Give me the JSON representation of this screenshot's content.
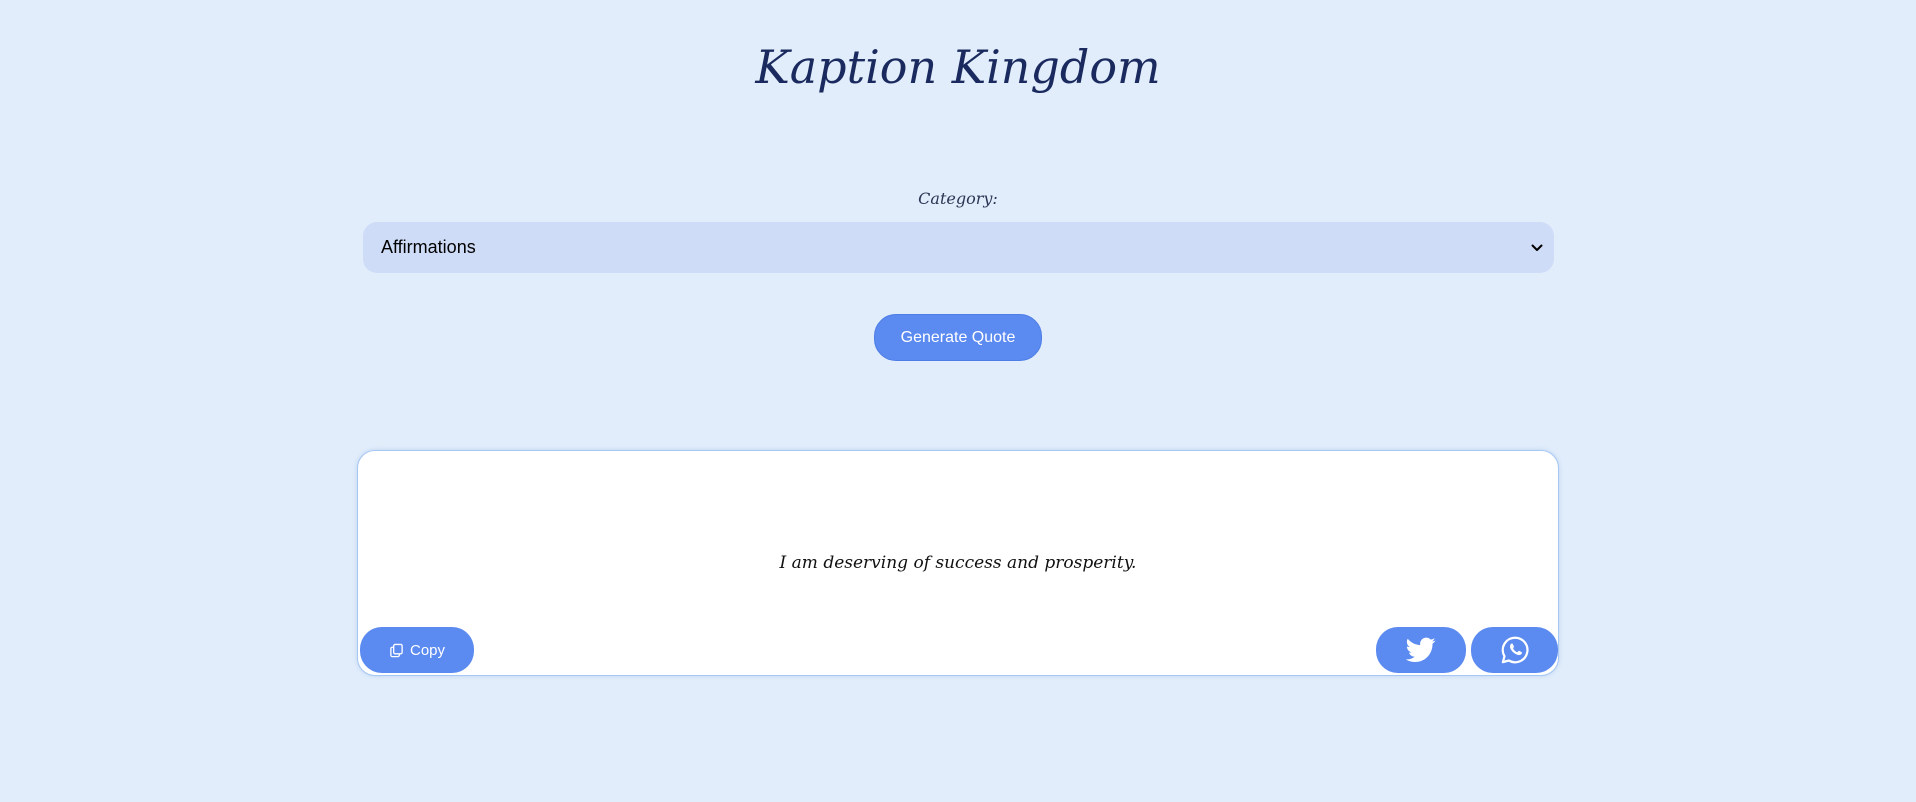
{
  "app": {
    "title": "Kaption Kingdom"
  },
  "category": {
    "label": "Category:",
    "selected": "Affirmations"
  },
  "actions": {
    "generate_label": "Generate Quote",
    "copy_label": "Copy"
  },
  "quote": {
    "text": "I am deserving of success and prosperity."
  },
  "icons": {
    "chevron": "chevron-down-icon",
    "copy": "copy-icon",
    "twitter": "twitter-icon",
    "whatsapp": "whatsapp-icon"
  },
  "colors": {
    "background": "#e1edfb",
    "accent": "#5b8af0",
    "title": "#1a2a5e",
    "select_bg": "#cfdcf7",
    "card_border": "#a7c8f4"
  }
}
